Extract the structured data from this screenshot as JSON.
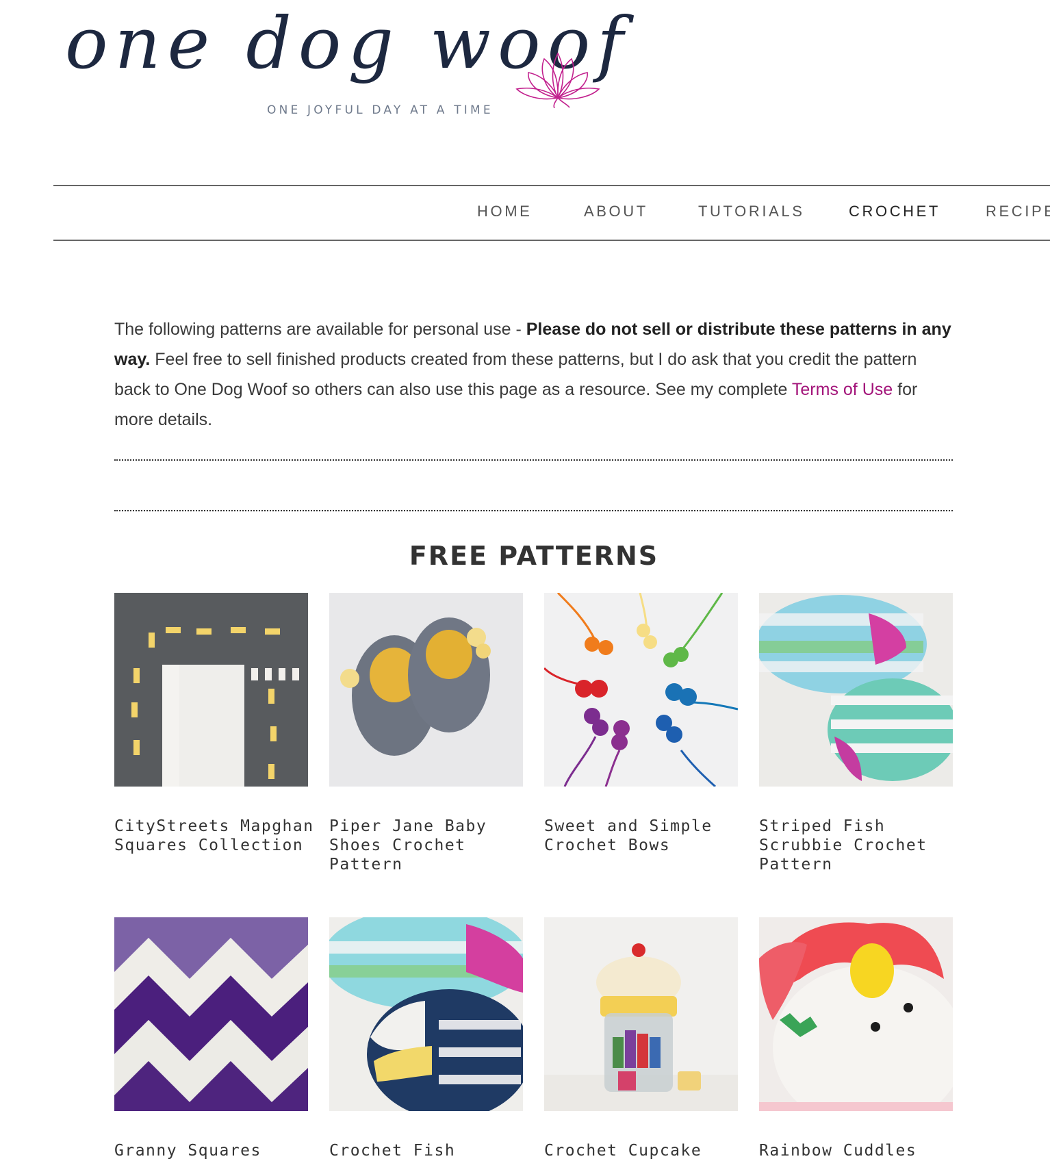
{
  "site": {
    "logo_text": "one dog woof",
    "tagline": "ONE JOYFUL DAY AT A TIME"
  },
  "nav": {
    "items": [
      {
        "label": "HOME"
      },
      {
        "label": "ABOUT"
      },
      {
        "label": "TUTORIALS"
      },
      {
        "label": "CROCHET"
      },
      {
        "label": "RECIPES"
      }
    ],
    "active": "CROCHET"
  },
  "intro": {
    "text1": "The following patterns are available for personal use - ",
    "bold": "Please do not sell or distribute these patterns in any way.",
    "text2": " Feel free to sell finished products created from these patterns, but I do ask that you credit the pattern back to One Dog Woof so others can also use this page as a resource. See my complete ",
    "link": "Terms of Use",
    "text3": " for more details."
  },
  "section": {
    "title": "FREE PATTERNS"
  },
  "patterns": [
    {
      "title": "CityStreets Mapghan Squares Collection"
    },
    {
      "title": "Piper Jane Baby Shoes Crochet Pattern"
    },
    {
      "title": "Sweet and Simple Crochet Bows"
    },
    {
      "title": "Striped Fish Scrubbie Crochet Pattern"
    },
    {
      "title": "Granny Squares"
    },
    {
      "title": "Crochet Fish"
    },
    {
      "title": "Crochet Cupcake"
    },
    {
      "title": "Rainbow Cuddles"
    }
  ],
  "colors": {
    "accent_link": "#a3147a",
    "logo_ink": "#1d2840",
    "lotus": "#c2218e"
  }
}
